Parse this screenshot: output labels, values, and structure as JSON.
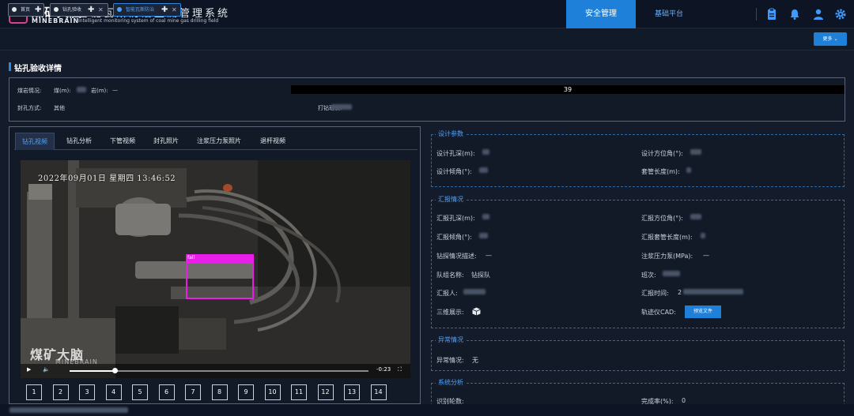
{
  "header": {
    "logo_letter": "M",
    "brand_cn": "煤矿大脑",
    "brand_en": "MINEBRAIN",
    "system_cn": "智能瓦斯防治监测管理系统",
    "system_en": "Intelligent monitoring system of coal mine gas drilling field",
    "nav": [
      {
        "label": "安全管理",
        "active": true
      },
      {
        "label": "基础平台",
        "active": false
      }
    ],
    "icons": [
      "clipboard-icon",
      "bell-icon",
      "user-icon",
      "settings-icon"
    ]
  },
  "tabs": [
    {
      "label": "首页",
      "closable": false,
      "active": false
    },
    {
      "label": "钻孔验收",
      "closable": true,
      "active": false
    },
    {
      "label": "智能瓦斯防治",
      "closable": true,
      "active": true
    }
  ],
  "more_button": "更多",
  "page_title": "钻孔验收详情",
  "info": {
    "coal_rock_label": "煤岩情况:",
    "coal_label": "煤(m):",
    "rock_label": "岩(m):",
    "rock_value": "—",
    "progress_value": "39",
    "seal_label": "封孔方式:",
    "seal_value": "其他",
    "drill_length_label": "打钻班长:"
  },
  "video_tabs": [
    {
      "label": "钻孔视频",
      "active": true
    },
    {
      "label": "钻孔分析",
      "active": false
    },
    {
      "label": "下管视频",
      "active": false
    },
    {
      "label": "封孔照片",
      "active": false
    },
    {
      "label": "注浆压力泵照片",
      "active": false
    },
    {
      "label": "退杆视频",
      "active": false
    }
  ],
  "video": {
    "timestamp": "2022年09月01日 星期四 13:46:52",
    "detection_label": "fall",
    "watermark_cn": "煤矿大脑",
    "watermark_en": "MINEBRAIN",
    "time_remaining": "-0:23",
    "progress": 0.15
  },
  "segments": [
    "1",
    "2",
    "3",
    "4",
    "5",
    "6",
    "7",
    "8",
    "9",
    "10",
    "11",
    "12",
    "13",
    "14"
  ],
  "design_params": {
    "title": "设计参数",
    "depth_label": "设计孔深(m):",
    "azimuth_label": "设计方位角(°):",
    "inclination_label": "设计倾角(°):",
    "casing_label": "套管长度(m):"
  },
  "report": {
    "title": "汇报情况",
    "depth_label": "汇报孔深(m):",
    "azimuth_label": "汇报方位角(°):",
    "inclination_label": "汇报倾角(°):",
    "casing_label": "汇报套管长度(m):",
    "desc_label": "钻探情况描述:",
    "desc_value": "—",
    "pressure_label": "注浆压力泵(MPa):",
    "pressure_value": "—",
    "team_label": "队组名称:",
    "team_value": "钻探队",
    "shift_label": "班次:",
    "reporter_label": "汇报人:",
    "report_time_label": "汇报时间:",
    "report_time_prefix": "2",
    "three_d_label": "三维展示:",
    "cad_label": "轨迹仪CAD:",
    "preview_button": "预览文件"
  },
  "abnormal": {
    "title": "异常情况",
    "label": "异常情况:",
    "value": "无"
  },
  "analysis": {
    "title": "系统分析",
    "row1_label": "识别轮数:",
    "row2_label": "完成率(%):",
    "row2_value": "0"
  },
  "colors": {
    "accent": "#1e80d8",
    "detection": "#e91ee9",
    "background": "#141c2c"
  }
}
